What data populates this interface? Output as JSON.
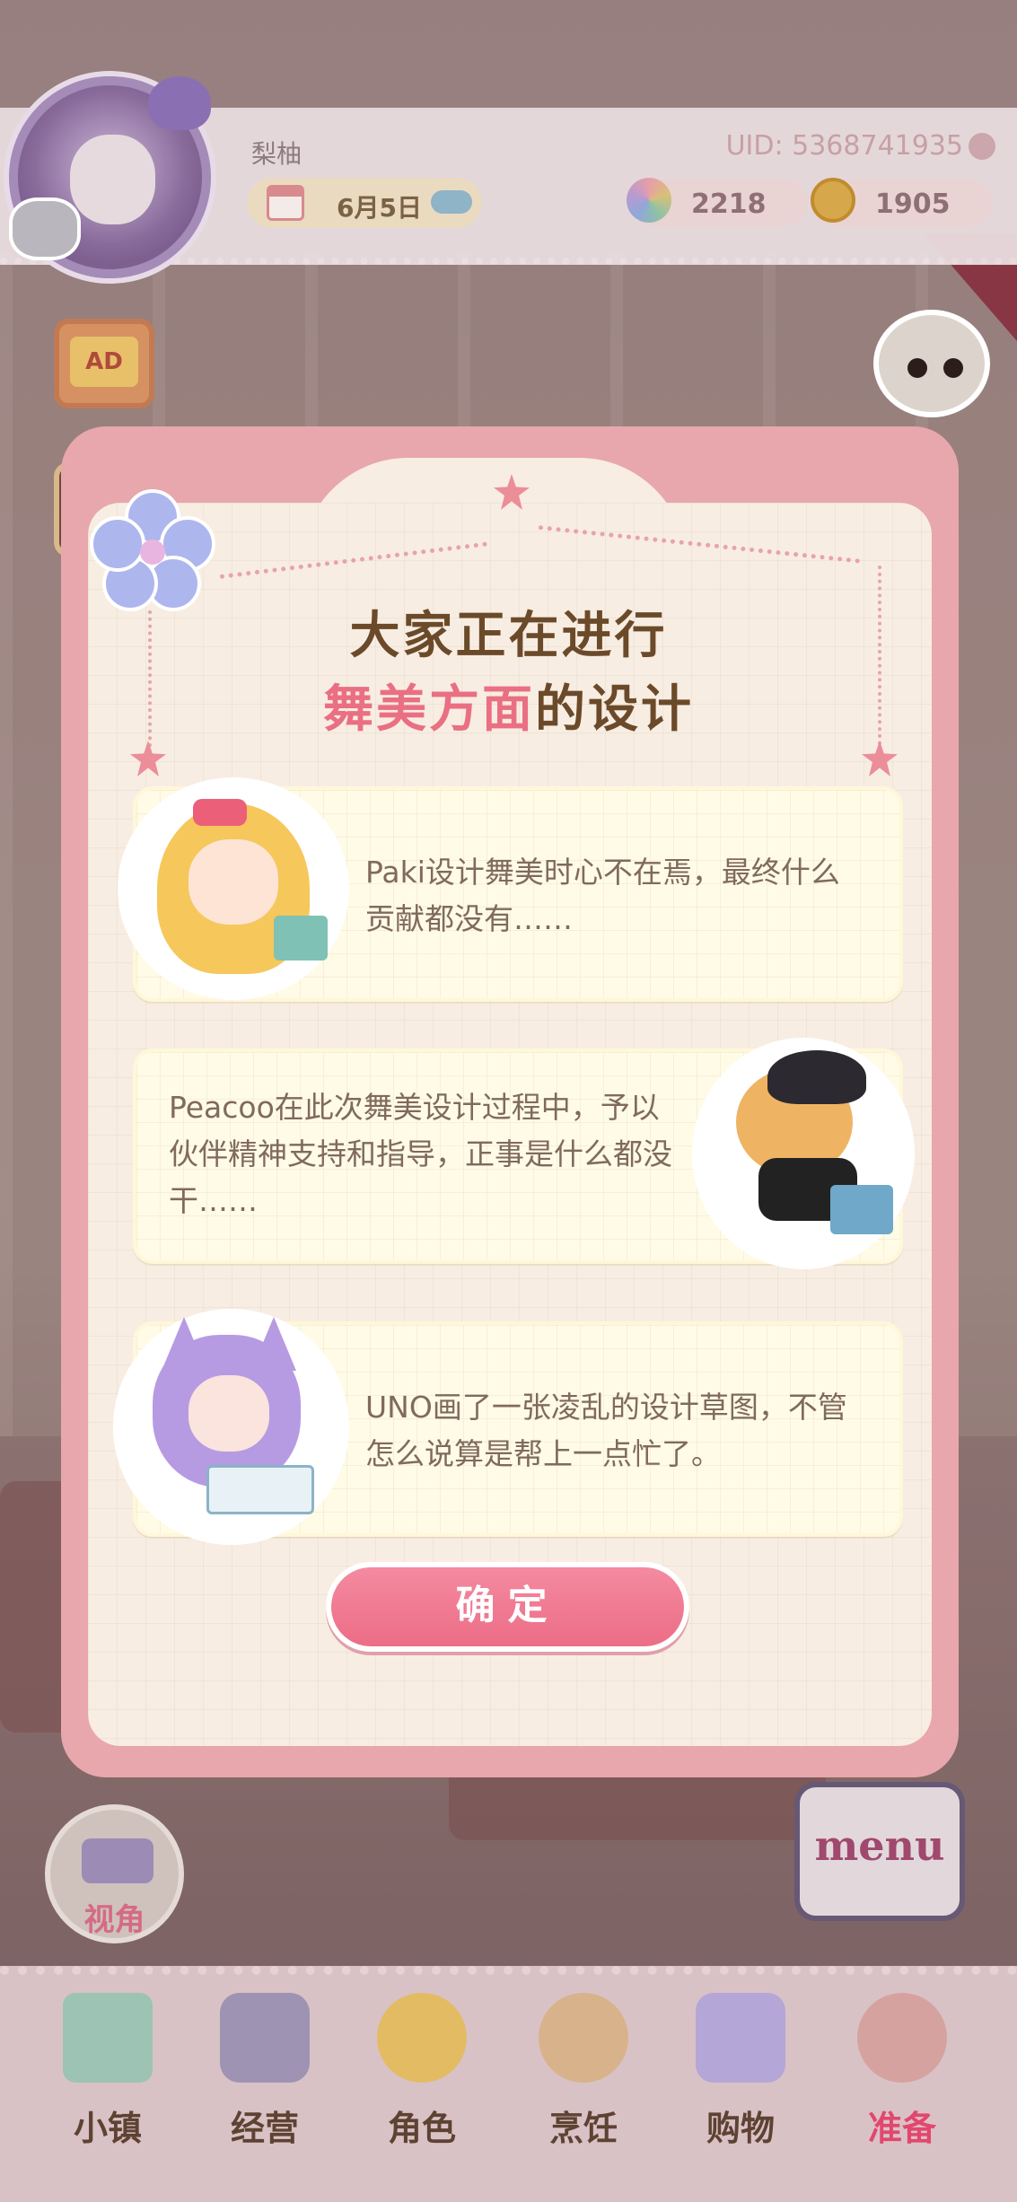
{
  "player": {
    "name": "梨柚",
    "uid": "UID: 5368741935",
    "date": "6月5日"
  },
  "currency": {
    "gems": "2218",
    "coins": "1905"
  },
  "side_buttons": {
    "ad_label": "AD"
  },
  "dialog": {
    "title_line1": "大家正在进行",
    "title_line2_highlight": "舞美方面",
    "title_line2_rest": "的设计",
    "cards": [
      {
        "character": "Paki",
        "text": "Paki设计舞美时心不在焉，最终什么贡献都没有……"
      },
      {
        "character": "Peacoo",
        "text": "Peacoo在此次舞美设计过程中，予以伙伴精神支持和指导，正事是什么都没干……"
      },
      {
        "character": "UNO",
        "text": "UNO画了一张凌乱的设计草图，不管怎么说算是帮上一点忙了。"
      }
    ],
    "confirm_label": "确定"
  },
  "hud": {
    "view_label": "视角",
    "menu_label": "menu"
  },
  "bottom_nav": [
    {
      "label": "小镇",
      "icon": "map-icon"
    },
    {
      "label": "经营",
      "icon": "briefcase-icon"
    },
    {
      "label": "角色",
      "icon": "character-icon"
    },
    {
      "label": "烹饪",
      "icon": "sandwich-icon"
    },
    {
      "label": "购物",
      "icon": "shopping-bag-icon"
    },
    {
      "label": "准备",
      "icon": "prep-basket-icon",
      "active": true
    }
  ],
  "colors": {
    "accent_pink": "#ec6d86",
    "title_brown": "#6b4a2a",
    "dialog_border": "#e8a7ad"
  }
}
